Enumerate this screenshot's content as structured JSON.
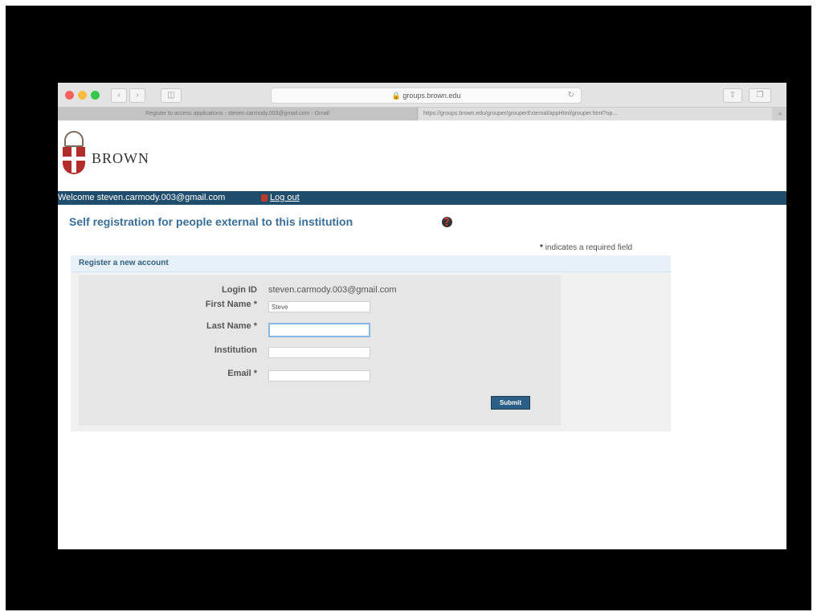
{
  "browser": {
    "address": "groups.brown.edu",
    "tabs": [
      "Register to access applications - steven.carmody.003@gmail.com - Gmail",
      "https://groups.brown.edu/grouper/grouperExternal/appHtml/grouper.html?op..."
    ]
  },
  "site": {
    "logo_text": "BROWN"
  },
  "navbar": {
    "welcome": "Welcome steven.carmody.003@gmail.com",
    "logout": "Log out"
  },
  "page": {
    "title": "Self registration for people external to this institution",
    "required_note_star": "*",
    "required_note": "indicates a required field"
  },
  "panel": {
    "title": "Register a new account"
  },
  "form": {
    "login_id_label": "Login ID",
    "login_id_value": "steven.carmody.003@gmail.com",
    "first_name_label": "First Name",
    "first_name_value": "Steve",
    "last_name_label": "Last Name",
    "last_name_value": "",
    "institution_label": "Institution",
    "institution_value": "",
    "email_label": "Email",
    "email_value": "",
    "required_marker": "*",
    "submit_label": "Submit"
  },
  "colors": {
    "navbar": "#1f4d6b",
    "title": "#3a6f9a",
    "submit": "#2c5f85"
  }
}
